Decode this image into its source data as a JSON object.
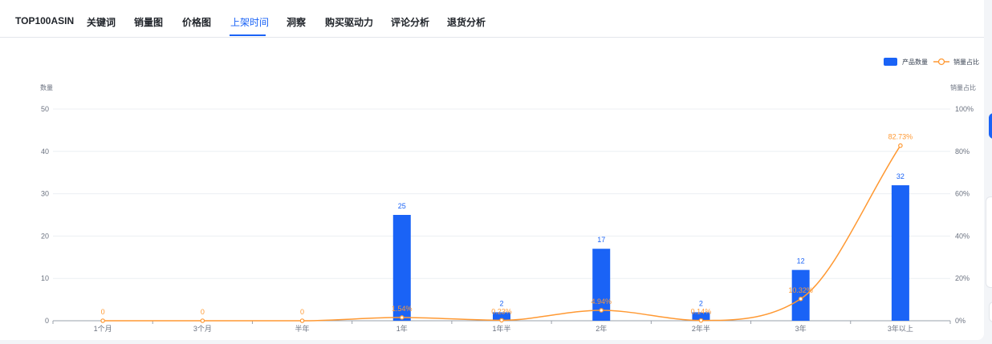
{
  "tabs": [
    {
      "label": "TOP100ASIN",
      "active": false
    },
    {
      "label": "关键词",
      "active": false
    },
    {
      "label": "销量图",
      "active": false
    },
    {
      "label": "价格图",
      "active": false
    },
    {
      "label": "上架时间",
      "active": true
    },
    {
      "label": "洞察",
      "active": false
    },
    {
      "label": "购买驱动力",
      "active": false
    },
    {
      "label": "评论分析",
      "active": false
    },
    {
      "label": "退货分析",
      "active": false
    }
  ],
  "colors": {
    "bar": "#1a63f6",
    "line": "#ff9933",
    "active_tab": "#1a63f6"
  },
  "chart_data": {
    "type": "bar",
    "categories": [
      "1个月",
      "3个月",
      "半年",
      "1年",
      "1年半",
      "2年",
      "2年半",
      "3年",
      "3年以上"
    ],
    "series": [
      {
        "name": "产品数量",
        "type": "bar",
        "axis": "left",
        "values": [
          0,
          0,
          0,
          25,
          2,
          17,
          2,
          12,
          32
        ]
      },
      {
        "name": "销量占比",
        "type": "line",
        "axis": "right",
        "values": [
          0,
          0,
          0,
          1.54,
          0.23,
          4.94,
          0.14,
          10.32,
          82.73
        ],
        "labels": [
          "0",
          "0",
          "0",
          "1.54%",
          "0.23%",
          "4.94%",
          "0.14%",
          "10.32%",
          "82.73%"
        ]
      }
    ],
    "ylabel_left": "数量",
    "ylabel_right": "销量占比",
    "ylim_left": [
      0,
      50
    ],
    "ylim_right": [
      0,
      100
    ],
    "yticks_left": [
      "0",
      "10",
      "20",
      "30",
      "40",
      "50"
    ],
    "yticks_right": [
      "0%",
      "20%",
      "40%",
      "60%",
      "80%",
      "100%"
    ],
    "legend": {
      "position": "top-right",
      "items": [
        "产品数量",
        "销量占比"
      ]
    },
    "grid": true
  }
}
